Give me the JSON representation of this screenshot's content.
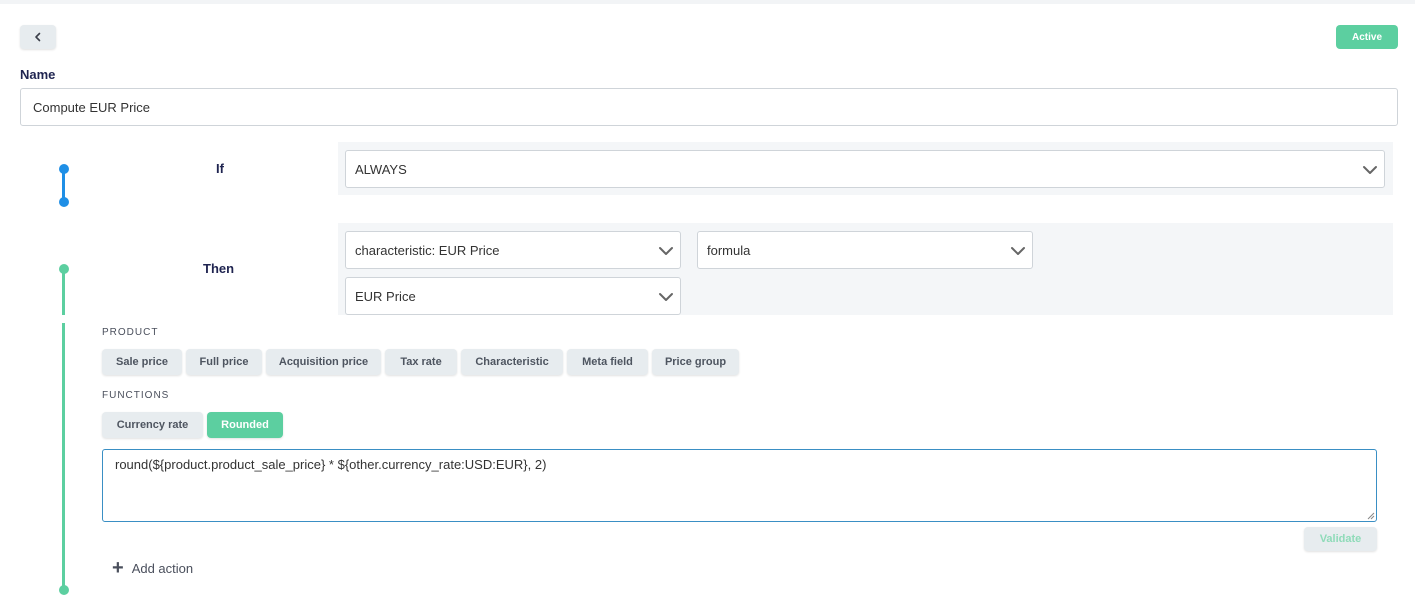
{
  "header": {
    "status_badge": "Active"
  },
  "name": {
    "label": "Name",
    "value": "Compute EUR Price"
  },
  "condition": {
    "label": "If",
    "selected": "ALWAYS"
  },
  "then": {
    "label": "Then",
    "target_select": "characteristic: EUR Price",
    "mode_select": "formula",
    "value_select": "EUR Price"
  },
  "product_section": {
    "label": "PRODUCT",
    "chips": [
      "Sale price",
      "Full price",
      "Acquisition price",
      "Tax rate",
      "Characteristic",
      "Meta field",
      "Price group"
    ]
  },
  "functions_section": {
    "label": "FUNCTIONS",
    "chips": [
      "Currency rate",
      "Rounded"
    ]
  },
  "formula": {
    "value": "round(${product.product_sale_price} * ${other.currency_rate:USD:EUR}, 2)"
  },
  "actions": {
    "validate_label": "Validate",
    "add_action_label": "Add action"
  },
  "colors": {
    "accent_green": "#5ccfa0",
    "accent_blue": "#1f8fe6"
  }
}
